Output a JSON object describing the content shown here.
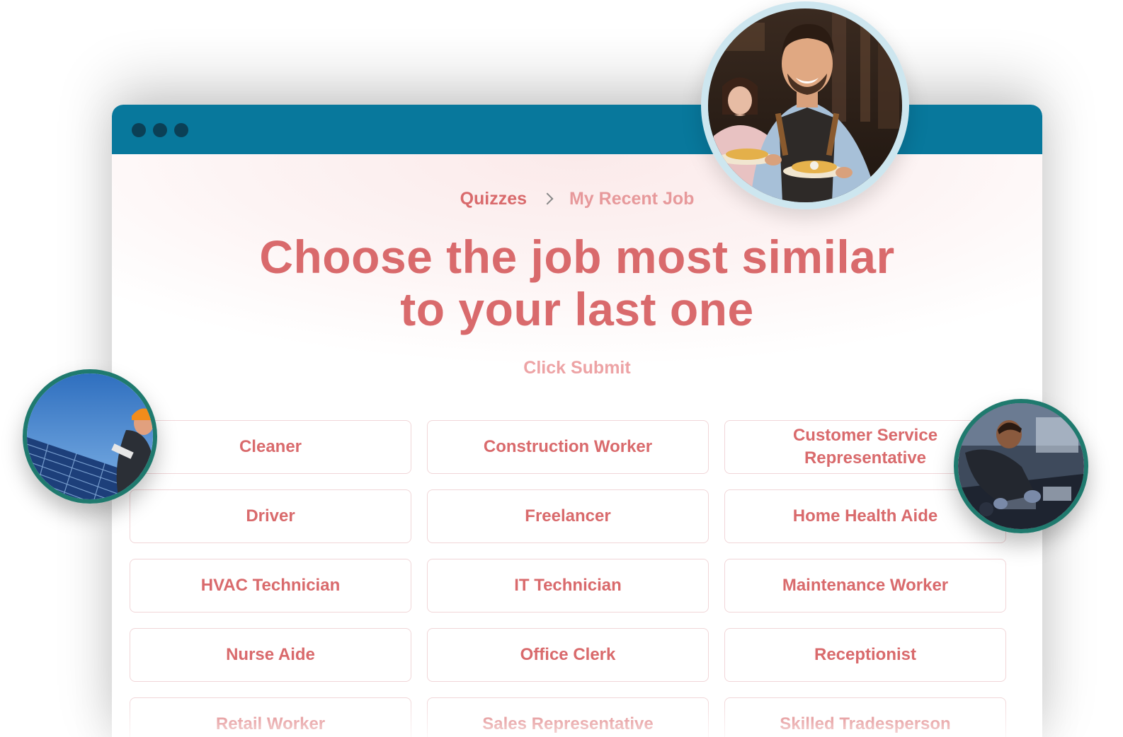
{
  "colors": {
    "titlebar": "#08789c",
    "dot": "#0b4056",
    "accent": "#d96a6c",
    "subtitle_accent": "#eda3a5",
    "breadcrumb_current": "#e7999b",
    "option_border": "#f1d6d8"
  },
  "breadcrumb": {
    "root": "Quizzes",
    "separator_icon": "chevron-right-icon",
    "current": "My Recent Job"
  },
  "heading": {
    "line1": "Choose the job most similar",
    "line2": "to your last one"
  },
  "subtitle": "Click Submit",
  "options": [
    "Cleaner",
    "Construction Worker",
    "Customer Service Representative",
    "Driver",
    "Freelancer",
    "Home Health Aide",
    "HVAC Technician",
    "IT Technician",
    "Maintenance Worker",
    "Nurse Aide",
    "Office Clerk",
    "Receptionist",
    "Retail Worker",
    "Sales Representative",
    "Skilled Tradesperson"
  ],
  "photos": {
    "waiter": "waiter-photo",
    "solar": "solar-installer-photo",
    "mechanic": "mechanic-photo"
  }
}
